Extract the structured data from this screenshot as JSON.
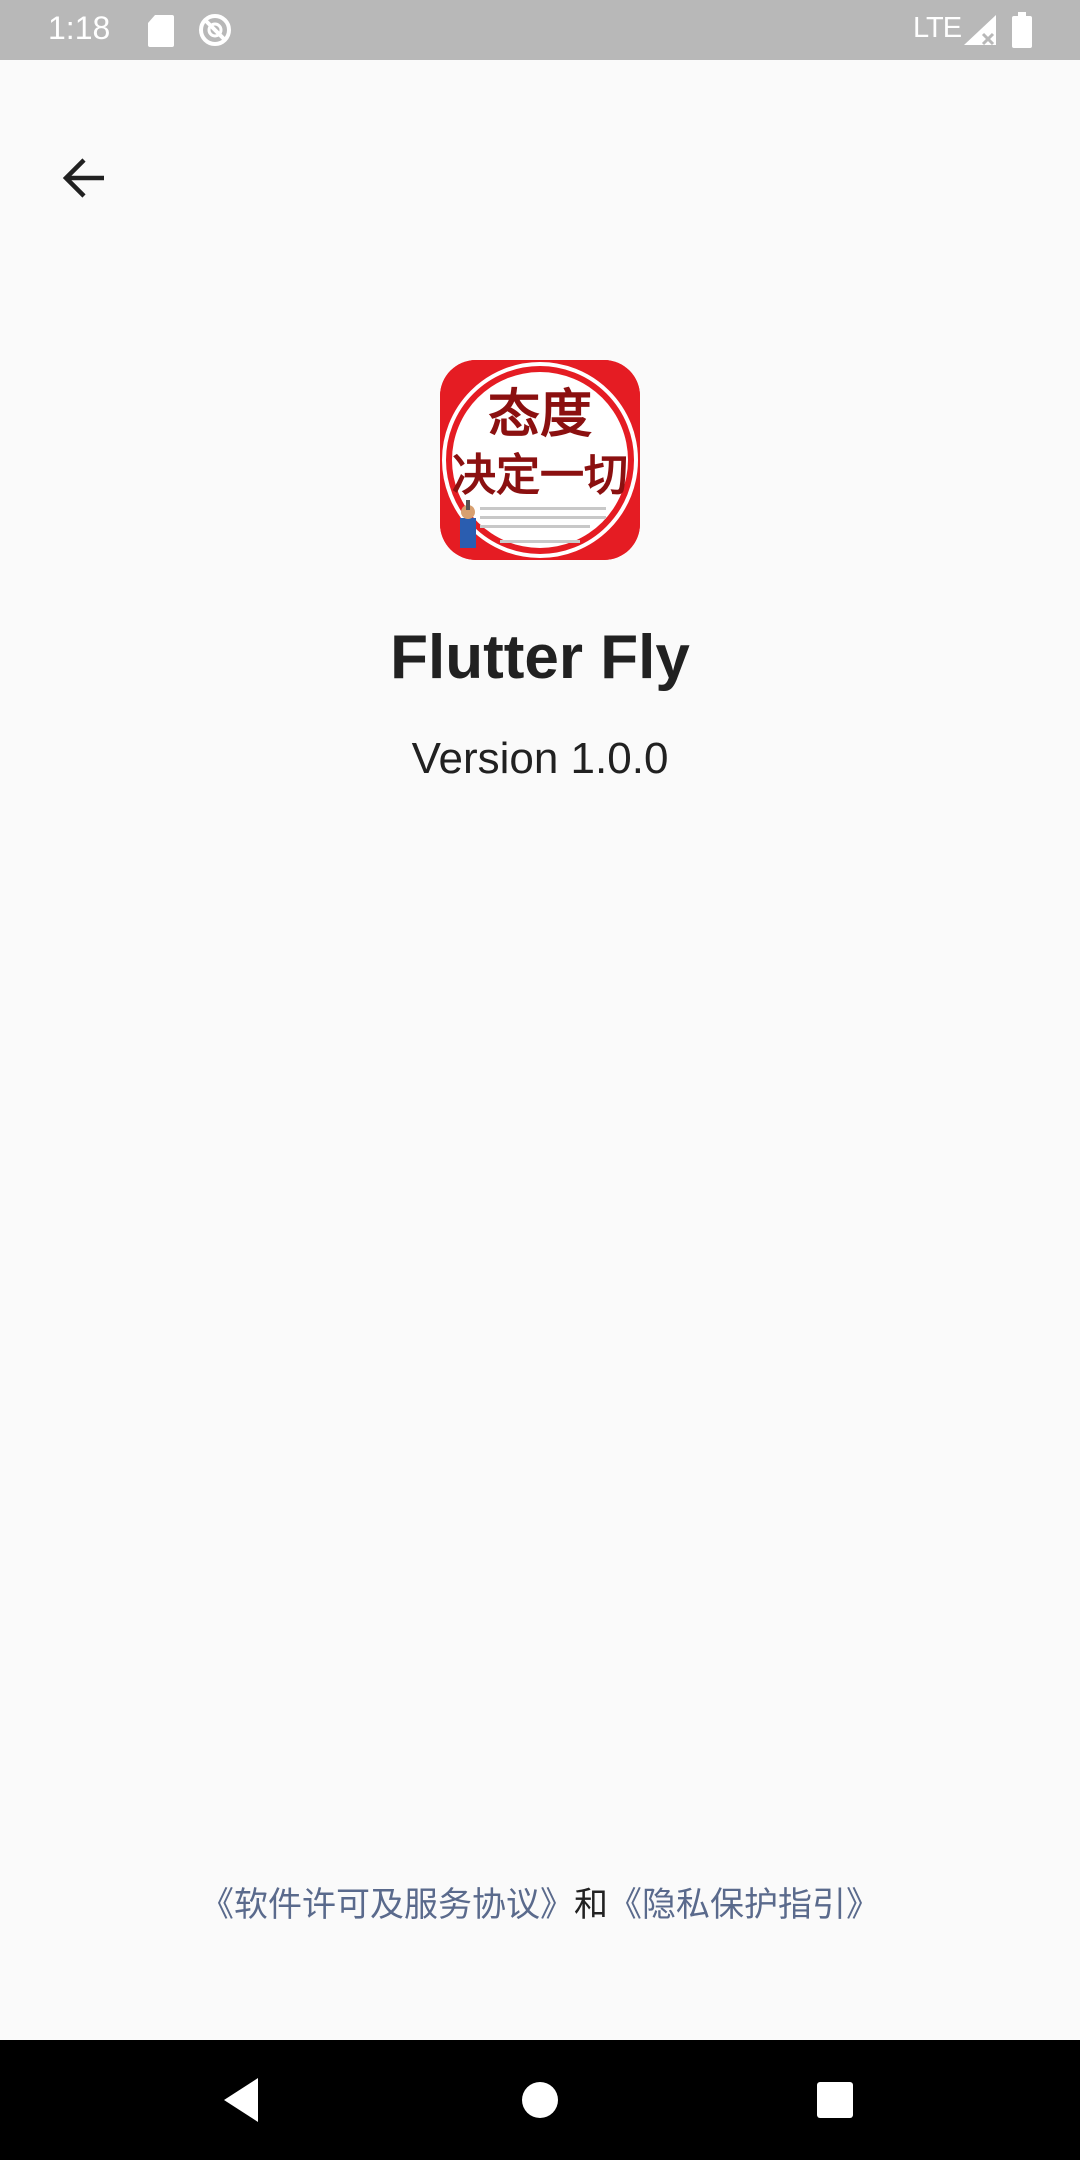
{
  "status_bar": {
    "time": "1:18",
    "network": "LTE",
    "icons": [
      "sd-card-icon",
      "no-disturb-icon",
      "signal-icon",
      "battery-icon"
    ]
  },
  "toolbar": {
    "back_icon": "arrow-left-icon"
  },
  "app": {
    "icon_title_line1": "态度",
    "icon_title_line2": "决定一切",
    "name": "Flutter Fly",
    "version": "Version 1.0.0"
  },
  "footer": {
    "license_link": "《软件许可及服务协议》",
    "conjunction": "和",
    "privacy_link": "《隐私保护指引》"
  },
  "nav_bar": {
    "back_icon": "triangle-back-icon",
    "home_icon": "circle-home-icon",
    "recents_icon": "square-recents-icon"
  },
  "colors": {
    "status_bar_bg": "#b8b8b8",
    "page_bg": "#fafafa",
    "link": "#5a6a8c",
    "text": "#212121",
    "icon_red": "#e51c23",
    "icon_title": "#8b1010",
    "nav_bg": "#000000"
  }
}
